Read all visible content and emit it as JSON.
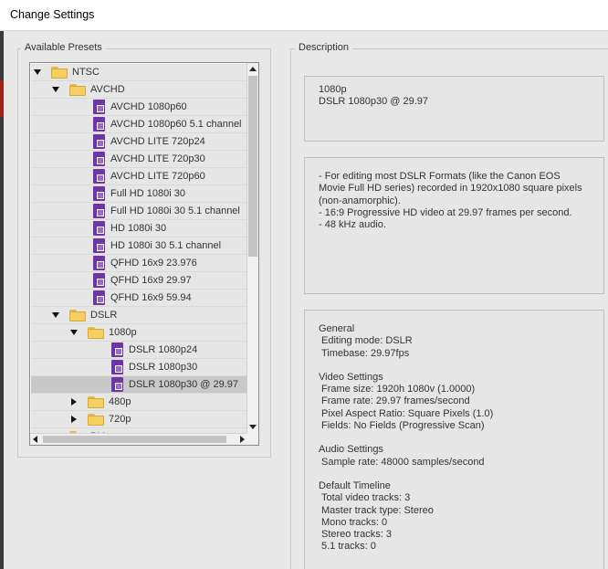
{
  "window": {
    "title": "Change Settings"
  },
  "presets": {
    "label": "Available Presets",
    "rows": [
      {
        "level": 0,
        "type": "folder",
        "expanded": true,
        "label": "NTSC"
      },
      {
        "level": 1,
        "type": "folder",
        "expanded": true,
        "label": "AVCHD"
      },
      {
        "level": 2,
        "type": "preset",
        "label": "AVCHD 1080p60"
      },
      {
        "level": 2,
        "type": "preset",
        "label": "AVCHD 1080p60 5.1 channel"
      },
      {
        "level": 2,
        "type": "preset",
        "label": "AVCHD LITE 720p24"
      },
      {
        "level": 2,
        "type": "preset",
        "label": "AVCHD LITE 720p30"
      },
      {
        "level": 2,
        "type": "preset",
        "label": "AVCHD LITE 720p60"
      },
      {
        "level": 2,
        "type": "preset",
        "label": "Full HD 1080i 30"
      },
      {
        "level": 2,
        "type": "preset",
        "label": "Full HD 1080i 30 5.1 channel"
      },
      {
        "level": 2,
        "type": "preset",
        "label": "HD 1080i 30"
      },
      {
        "level": 2,
        "type": "preset",
        "label": "HD 1080i 30 5.1 channel"
      },
      {
        "level": 2,
        "type": "preset",
        "label": "QFHD 16x9 23.976"
      },
      {
        "level": 2,
        "type": "preset",
        "label": "QFHD 16x9 29.97"
      },
      {
        "level": 2,
        "type": "preset",
        "label": "QFHD 16x9 59.94"
      },
      {
        "level": 1,
        "type": "folder",
        "expanded": true,
        "label": "DSLR"
      },
      {
        "level": 2,
        "type": "folder",
        "expanded": true,
        "label": "1080p"
      },
      {
        "level": 3,
        "type": "preset",
        "label": "DSLR 1080p24"
      },
      {
        "level": 3,
        "type": "preset",
        "label": "DSLR 1080p30"
      },
      {
        "level": 3,
        "type": "preset",
        "label": "DSLR 1080p30 @ 29.97",
        "selected": true
      },
      {
        "level": 2,
        "type": "folder",
        "expanded": false,
        "label": "480p"
      },
      {
        "level": 2,
        "type": "folder",
        "expanded": false,
        "label": "720p"
      },
      {
        "level": 1,
        "type": "folder",
        "expanded": false,
        "label": "DV"
      }
    ]
  },
  "description": {
    "label": "Description",
    "summary": [
      "1080p",
      "DSLR 1080p30 @ 29.97"
    ],
    "notes": [
      "- For editing most DSLR Formats (like the Canon EOS",
      "Movie Full HD series) recorded in 1920x1080 square pixels",
      "(non-anamorphic).",
      "- 16:9 Progressive HD video at 29.97 frames per second.",
      "- 48 kHz audio."
    ],
    "details": [
      {
        "heading": "General",
        "items": [
          "Editing mode: DSLR",
          "Timebase: 29.97fps"
        ]
      },
      {
        "heading": "Video Settings",
        "items": [
          "Frame size: 1920h 1080v (1.0000)",
          "Frame rate: 29.97 frames/second",
          "Pixel Aspect Ratio: Square Pixels (1.0)",
          "Fields: No Fields (Progressive Scan)"
        ]
      },
      {
        "heading": "Audio Settings",
        "items": [
          "Sample rate: 48000 samples/second"
        ]
      },
      {
        "heading": "Default Timeline",
        "items": [
          "Total video tracks: 3",
          "Master track type: Stereo",
          "Mono tracks: 0",
          "Stereo tracks: 3",
          "5.1 tracks: 0"
        ]
      }
    ]
  }
}
